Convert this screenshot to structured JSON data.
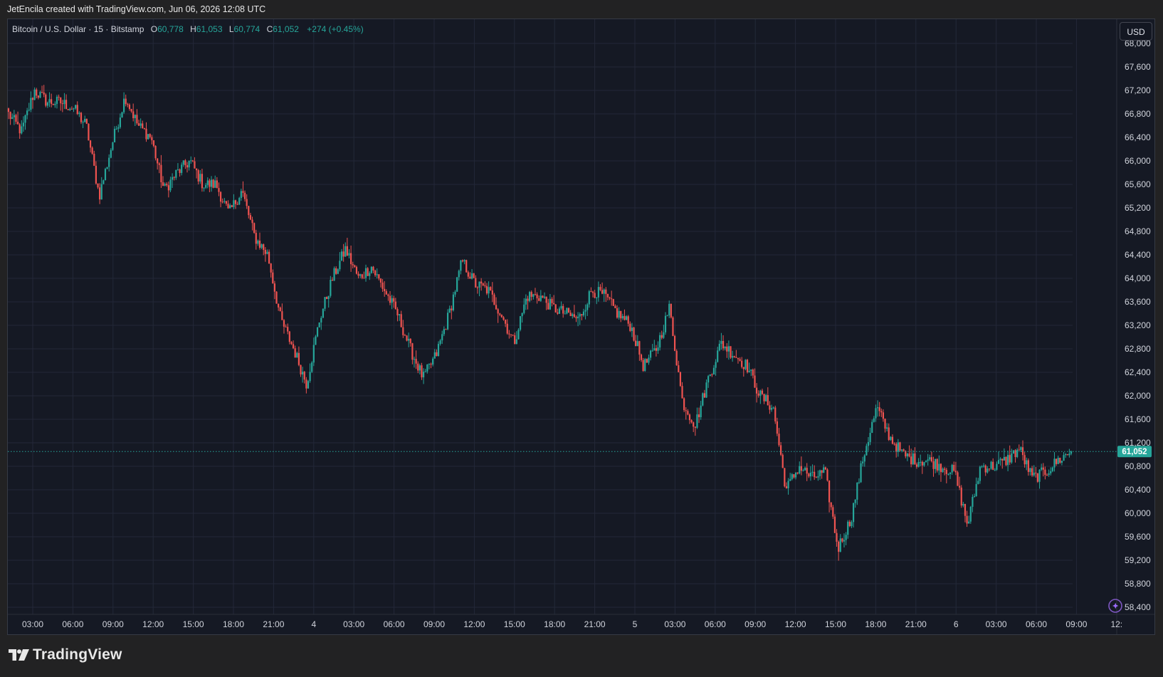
{
  "caption": "JetEncila created with TradingView.com, Jun 06, 2026 12:08 UTC",
  "legend": {
    "symbol": "Bitcoin / U.S. Dollar · 15 · Bitstamp",
    "o_label": "O",
    "o_value": "60,778",
    "h_label": "H",
    "h_value": "61,053",
    "l_label": "L",
    "l_value": "60,774",
    "c_label": "C",
    "c_value": "61,052",
    "change": "+274 (+0.45%)"
  },
  "currency_button": "USD",
  "brand": {
    "name": "TradingView",
    "icon": "tradingview-logo-icon"
  },
  "chart_badge_icon": "magic-sparkle-icon",
  "colors": {
    "up": "#26a69a",
    "down": "#ef5350",
    "background": "#151924",
    "grid": "#232838",
    "text": "#d1d4dc"
  },
  "chart_data": {
    "type": "candlestick",
    "interval_minutes": 15,
    "grid": true,
    "last_price": 61052,
    "last_price_label": "61,052",
    "y_ticks": [
      58400,
      58800,
      59200,
      59600,
      60000,
      60400,
      60800,
      61200,
      61600,
      62000,
      62400,
      62800,
      63200,
      63600,
      64000,
      64400,
      64800,
      65200,
      65600,
      66000,
      66400,
      66800,
      67200,
      67600,
      68000
    ],
    "y_tick_labels": [
      "58,400",
      "58,800",
      "59,200",
      "59,600",
      "60,000",
      "60,400",
      "60,800",
      "61,200",
      "61,600",
      "62,000",
      "62,400",
      "62,800",
      "63,200",
      "63,600",
      "64,000",
      "64,400",
      "64,800",
      "65,200",
      "65,600",
      "66,000",
      "66,400",
      "66,800",
      "67,200",
      "67,600",
      "68,000"
    ],
    "x_ticks": [
      "03:00",
      "06:00",
      "09:00",
      "12:00",
      "15:00",
      "18:00",
      "21:00",
      "4",
      "03:00",
      "06:00",
      "09:00",
      "12:00",
      "15:00",
      "18:00",
      "21:00",
      "5",
      "03:00",
      "06:00",
      "09:00",
      "12:00",
      "15:00",
      "18:00",
      "21:00",
      "6",
      "03:00",
      "06:00",
      "09:00",
      "12:"
    ],
    "path": [
      [
        0,
        66800
      ],
      [
        1,
        66500
      ],
      [
        2,
        67200
      ],
      [
        3,
        67000
      ],
      [
        4,
        67000
      ],
      [
        5,
        66900
      ],
      [
        6,
        66600
      ],
      [
        7,
        65400
      ],
      [
        8,
        66300
      ],
      [
        9,
        67100
      ],
      [
        10,
        66600
      ],
      [
        11,
        66400
      ],
      [
        12,
        65500
      ],
      [
        13,
        65800
      ],
      [
        14,
        66000
      ],
      [
        15,
        65600
      ],
      [
        16,
        65600
      ],
      [
        17,
        65100
      ],
      [
        18,
        65500
      ],
      [
        19,
        64700
      ],
      [
        20,
        64400
      ],
      [
        21,
        63300
      ],
      [
        22,
        62800
      ],
      [
        23,
        62200
      ],
      [
        24,
        63300
      ],
      [
        25,
        64000
      ],
      [
        26,
        64500
      ],
      [
        27,
        64000
      ],
      [
        28,
        64200
      ],
      [
        29,
        63800
      ],
      [
        30,
        63400
      ],
      [
        31,
        62800
      ],
      [
        32,
        62300
      ],
      [
        33,
        62700
      ],
      [
        34,
        63400
      ],
      [
        35,
        64300
      ],
      [
        36,
        63900
      ],
      [
        37,
        63800
      ],
      [
        38,
        63400
      ],
      [
        39,
        62900
      ],
      [
        40,
        63700
      ],
      [
        41,
        63700
      ],
      [
        42,
        63500
      ],
      [
        43,
        63400
      ],
      [
        44,
        63300
      ],
      [
        45,
        63800
      ],
      [
        46,
        63700
      ],
      [
        47,
        63400
      ],
      [
        48,
        63200
      ],
      [
        49,
        62500
      ],
      [
        50,
        62800
      ],
      [
        51,
        63500
      ],
      [
        52,
        61900
      ],
      [
        53,
        61500
      ],
      [
        54,
        62300
      ],
      [
        55,
        62900
      ],
      [
        56,
        62700
      ],
      [
        57,
        62500
      ],
      [
        58,
        62000
      ],
      [
        59,
        61800
      ],
      [
        60,
        60400
      ],
      [
        61,
        60800
      ],
      [
        62,
        60600
      ],
      [
        63,
        60700
      ],
      [
        64,
        59400
      ],
      [
        65,
        59900
      ],
      [
        66,
        61000
      ],
      [
        67,
        61800
      ],
      [
        68,
        61300
      ],
      [
        69,
        61000
      ],
      [
        70,
        60900
      ],
      [
        71,
        60900
      ],
      [
        72,
        60800
      ],
      [
        73,
        60700
      ],
      [
        74,
        59800
      ],
      [
        75,
        60800
      ],
      [
        76,
        60800
      ],
      [
        77,
        60900
      ],
      [
        78,
        61100
      ],
      [
        79,
        60600
      ],
      [
        80,
        60700
      ],
      [
        81,
        60900
      ],
      [
        82,
        61050
      ]
    ],
    "source_extremes": {
      "high": 67400,
      "low": 59100
    }
  }
}
